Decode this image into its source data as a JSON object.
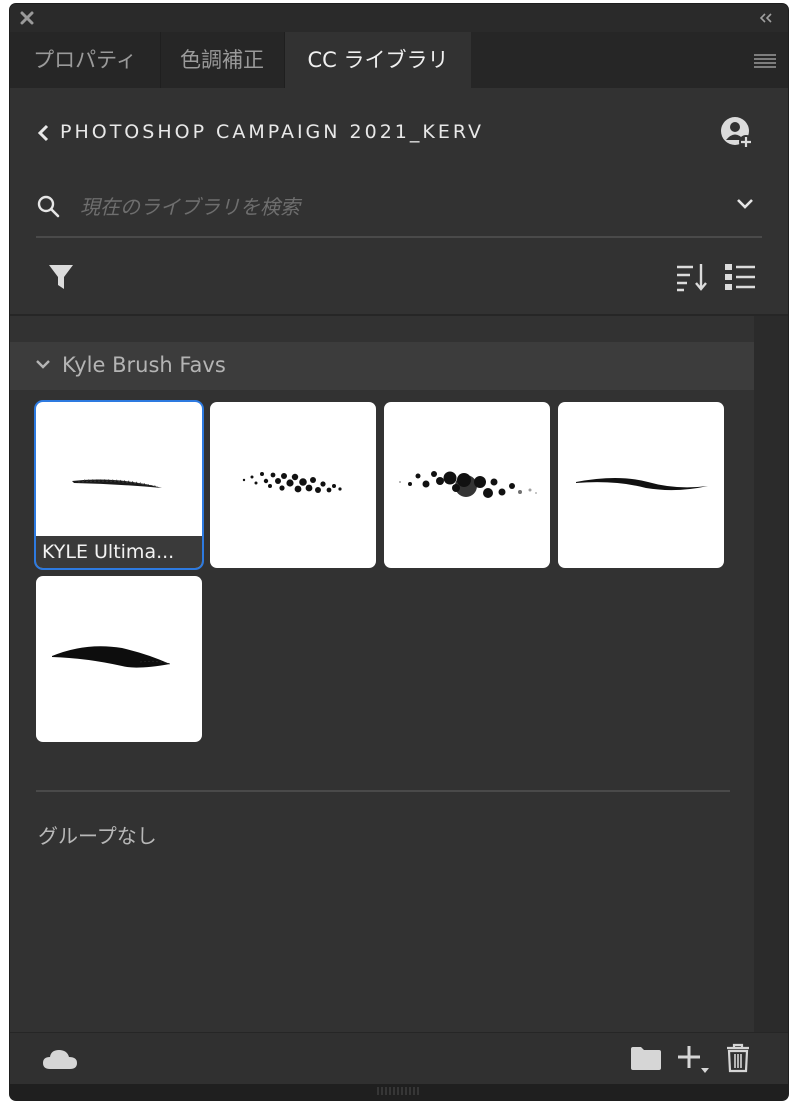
{
  "window": {
    "close_icon": "close-icon",
    "collapse_icon": "double-chevron-left-icon"
  },
  "tabs": [
    {
      "label": "プロパティ",
      "active": false
    },
    {
      "label": "色調補正",
      "active": false
    },
    {
      "label": "CC ライブラリ",
      "active": true
    }
  ],
  "tab_menu_icon": "hamburger-menu-icon",
  "library": {
    "title": "PHOTOSHOP CAMPAIGN 2021_KERV",
    "back_icon": "chevron-left-icon",
    "invite_icon": "invite-user-icon"
  },
  "search": {
    "placeholder": "現在のライブラリを検索",
    "value": ""
  },
  "toolbar": {
    "filter_icon": "filter-icon",
    "sort_icon": "sort-icon",
    "view_icon": "list-view-icon"
  },
  "group": {
    "name": "Kyle Brush Favs",
    "expanded": true,
    "items": [
      {
        "label": "KYLE Ultima...",
        "selected": true,
        "preview": "thin-dry-stroke"
      },
      {
        "label": "",
        "selected": false,
        "preview": "halftone-dots-stroke"
      },
      {
        "label": "",
        "selected": false,
        "preview": "blurred-dots-stroke"
      },
      {
        "label": "",
        "selected": false,
        "preview": "smooth-tapered-stroke"
      },
      {
        "label": "",
        "selected": false,
        "preview": "bold-ink-stroke"
      }
    ]
  },
  "ungrouped": {
    "label": "グループなし"
  },
  "colors": {
    "panel_bg": "#323232",
    "selection_accent": "#2d7ae0"
  }
}
